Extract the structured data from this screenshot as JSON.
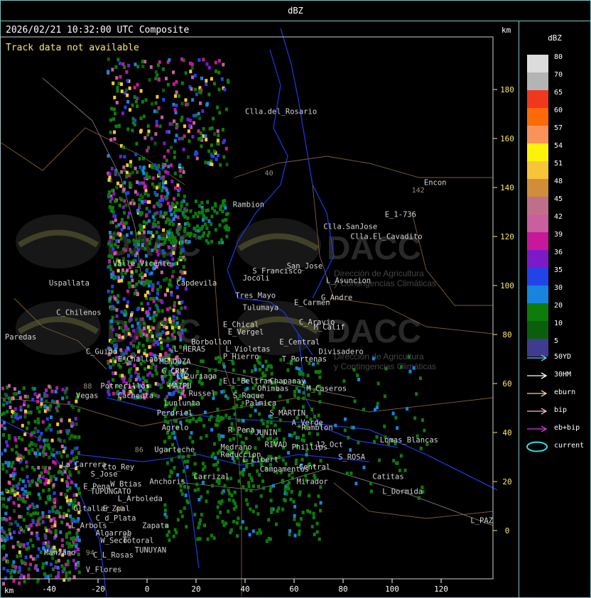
{
  "header": {
    "title": "dBZ"
  },
  "map": {
    "timestamp": "2026/02/21 10:32:00 UTC Composite",
    "notice": "Track data not available",
    "unit_top": "km",
    "unit_bottom": "km",
    "watermark_brand": "DACC",
    "watermark_line1": "Dirección de Agricultura",
    "watermark_line2": "y Contingencias Climáticas",
    "x_ticks": [
      "-40",
      "-20",
      "0",
      "20",
      "40",
      "60",
      "80",
      "100",
      "120"
    ],
    "y_ticks": [
      "180",
      "160",
      "140",
      "120",
      "100",
      "80",
      "60",
      "40",
      "20",
      "0"
    ],
    "places": [
      {
        "name": "Clla.del_Rosario",
        "x": 40,
        "y": 170
      },
      {
        "name": "Encon",
        "x": 113,
        "y": 141
      },
      {
        "name": "E_1-736",
        "x": 97,
        "y": 128
      },
      {
        "name": "Rambion",
        "x": 35,
        "y": 132
      },
      {
        "name": "Clla.SanJose",
        "x": 72,
        "y": 123
      },
      {
        "name": "Clla.El_Cavadito",
        "x": 83,
        "y": 119
      },
      {
        "name": "Uspallata",
        "x": -40,
        "y": 100
      },
      {
        "name": "C_Chilenos",
        "x": -37,
        "y": 88
      },
      {
        "name": "Valle_Vicente",
        "x": -14,
        "y": 108
      },
      {
        "name": "Capdevila",
        "x": 12,
        "y": 100
      },
      {
        "name": "S_Francisco",
        "x": 43,
        "y": 105
      },
      {
        "name": "San_Jose",
        "x": 57,
        "y": 107
      },
      {
        "name": "Jocoli",
        "x": 39,
        "y": 102
      },
      {
        "name": "L_Asuncion",
        "x": 73,
        "y": 101
      },
      {
        "name": "Tres_Mayo",
        "x": 36,
        "y": 95
      },
      {
        "name": "Tulumaya",
        "x": 39,
        "y": 90
      },
      {
        "name": "E_Carmen",
        "x": 60,
        "y": 92
      },
      {
        "name": "G_Andre",
        "x": 71,
        "y": 94
      },
      {
        "name": "C_Aravio",
        "x": 62,
        "y": 84
      },
      {
        "name": "M_Calif",
        "x": 68,
        "y": 82
      },
      {
        "name": "E_Chical",
        "x": 31,
        "y": 83
      },
      {
        "name": "E_Vergel",
        "x": 33,
        "y": 80
      },
      {
        "name": "Borbollon",
        "x": 18,
        "y": 76
      },
      {
        "name": "L_Violetas",
        "x": 32,
        "y": 73
      },
      {
        "name": "E_Central",
        "x": 54,
        "y": 76
      },
      {
        "name": "Divisadero",
        "x": 70,
        "y": 72
      },
      {
        "name": "L_HERAS",
        "x": 11,
        "y": 73
      },
      {
        "name": "P_Hierro",
        "x": 31,
        "y": 70
      },
      {
        "name": "C_Guido",
        "x": -25,
        "y": 72
      },
      {
        "name": "E_Challao",
        "x": -12,
        "y": 69
      },
      {
        "name": "MENDOZA",
        "x": 5,
        "y": 68
      },
      {
        "name": "T_Portenas",
        "x": 55,
        "y": 69
      },
      {
        "name": "G_CRUZ",
        "x": 6,
        "y": 64
      },
      {
        "name": "Luzuriaga",
        "x": 12,
        "y": 62
      },
      {
        "name": "Chapanay",
        "x": 50,
        "y": 60
      },
      {
        "name": "MAIPU",
        "x": 9,
        "y": 58
      },
      {
        "name": "E_L_Beltran",
        "x": 31,
        "y": 60
      },
      {
        "name": "Ohimbas",
        "x": 45,
        "y": 57
      },
      {
        "name": "M_Caseros",
        "x": 65,
        "y": 57
      },
      {
        "name": "Potrerillos",
        "x": -19,
        "y": 58
      },
      {
        "name": "Russel",
        "x": 17,
        "y": 55
      },
      {
        "name": "S_Roque",
        "x": 35,
        "y": 54
      },
      {
        "name": "Vegas",
        "x": -29,
        "y": 54
      },
      {
        "name": "Cacheuta",
        "x": -12,
        "y": 54
      },
      {
        "name": "Lunlunta",
        "x": 7,
        "y": 51
      },
      {
        "name": "Palmica",
        "x": 40,
        "y": 51
      },
      {
        "name": "S_MARTIN",
        "x": 50,
        "y": 47
      },
      {
        "name": "Perdriel",
        "x": 4,
        "y": 47
      },
      {
        "name": "A_Verde",
        "x": 59,
        "y": 43
      },
      {
        "name": "Ramblon",
        "x": 63,
        "y": 41
      },
      {
        "name": "Agrelo",
        "x": 6,
        "y": 41
      },
      {
        "name": "R_Pena",
        "x": 33,
        "y": 40
      },
      {
        "name": "JUNIN",
        "x": 44,
        "y": 39
      },
      {
        "name": "Lomas_Blancas",
        "x": 95,
        "y": 36
      },
      {
        "name": "Ugarteche",
        "x": 3,
        "y": 32
      },
      {
        "name": "Medrano",
        "x": 30,
        "y": 33
      },
      {
        "name": "RIVAD",
        "x": 48,
        "y": 34
      },
      {
        "name": "Phillips",
        "x": 59,
        "y": 33
      },
      {
        "name": "12_Oct",
        "x": 69,
        "y": 34
      },
      {
        "name": "Reduccion",
        "x": 30,
        "y": 30
      },
      {
        "name": "L_Libert",
        "x": 39,
        "y": 28
      },
      {
        "name": "S_ROSA",
        "x": 78,
        "y": 29
      },
      {
        "name": "La_Carrera",
        "x": -35,
        "y": 26
      },
      {
        "name": "Cto_Rey",
        "x": -18,
        "y": 25
      },
      {
        "name": "Campamentos",
        "x": 46,
        "y": 24
      },
      {
        "name": "Central",
        "x": 62,
        "y": 25
      },
      {
        "name": "S_Jose",
        "x": -23,
        "y": 22
      },
      {
        "name": "Carrizal",
        "x": 19,
        "y": 21
      },
      {
        "name": "Catitas",
        "x": 92,
        "y": 21
      },
      {
        "name": "W_Btias",
        "x": -15,
        "y": 18
      },
      {
        "name": "Anchoris",
        "x": 1,
        "y": 19
      },
      {
        "name": "Mirador",
        "x": 61,
        "y": 19
      },
      {
        "name": "E_Pena",
        "x": -26,
        "y": 17
      },
      {
        "name": "TUPUNGATO",
        "x": -23,
        "y": 15
      },
      {
        "name": "L_Dormida",
        "x": 96,
        "y": 15
      },
      {
        "name": "L_Arboleda",
        "x": -12,
        "y": 12
      },
      {
        "name": "Gltallar",
        "x": -30,
        "y": 8
      },
      {
        "name": "E_Zpal",
        "x": -18,
        "y": 8
      },
      {
        "name": "C_d_Plata",
        "x": -21,
        "y": 4
      },
      {
        "name": "L_Arbols",
        "x": -31,
        "y": 1
      },
      {
        "name": "Zapata",
        "x": -2,
        "y": 1
      },
      {
        "name": "L_PAZ",
        "x": 132,
        "y": 3
      },
      {
        "name": "Algarrob",
        "x": -21,
        "y": -2
      },
      {
        "name": "W_Seco",
        "x": -19,
        "y": -5
      },
      {
        "name": "Totoral",
        "x": -10,
        "y": -5
      },
      {
        "name": "TUNUYAN",
        "x": -5,
        "y": -9
      },
      {
        "name": "Manzano",
        "x": -42,
        "y": -10
      },
      {
        "name": "C_L_Rosas",
        "x": -22,
        "y": -11
      },
      {
        "name": "V_Flores",
        "x": -25,
        "y": -17
      },
      {
        "name": "Paredas",
        "x": -58,
        "y": 78
      }
    ],
    "road_numbers": [
      {
        "label": "40",
        "x": 48,
        "y": 145
      },
      {
        "label": "142",
        "x": 108,
        "y": 138
      },
      {
        "label": "88",
        "x": -26,
        "y": 58
      },
      {
        "label": "86",
        "x": -5,
        "y": 32
      },
      {
        "label": "40",
        "x": -13,
        "y": 8
      },
      {
        "label": "94",
        "x": -25,
        "y": -10
      },
      {
        "label": "40",
        "x": -10,
        "y": -3
      }
    ]
  },
  "legend": {
    "title": "dBZ",
    "bins": [
      {
        "label": "80",
        "color": "#dcdcdc"
      },
      {
        "label": "70",
        "color": "#b4b4b4"
      },
      {
        "label": "65",
        "color": "#f0381e"
      },
      {
        "label": "60",
        "color": "#fc6a08"
      },
      {
        "label": "57",
        "color": "#f9935a"
      },
      {
        "label": "54",
        "color": "#fcf20c"
      },
      {
        "label": "51",
        "color": "#f7c539"
      },
      {
        "label": "48",
        "color": "#d28d3a"
      },
      {
        "label": "45",
        "color": "#c06f8a"
      },
      {
        "label": "42",
        "color": "#c95f9d"
      },
      {
        "label": "39",
        "color": "#c7179b"
      },
      {
        "label": "36",
        "color": "#7c1ac9"
      },
      {
        "label": "35",
        "color": "#2243e8"
      },
      {
        "label": "30",
        "color": "#1784de"
      },
      {
        "label": "20",
        "color": "#0d7c0c"
      },
      {
        "label": "10",
        "color": "#0b5e0c"
      },
      {
        "label": "5",
        "color": "#3f3b8e"
      }
    ],
    "tracks": [
      {
        "label": "50YD",
        "color": "#5fd3e0"
      },
      {
        "label": "30HM",
        "color": "#ffffff"
      },
      {
        "label": "eburn",
        "color": "#f2cf98"
      },
      {
        "label": "bip",
        "color": "#f4b9c8"
      },
      {
        "label": "eb+bip",
        "color": "#d33ce0"
      },
      {
        "label": "current",
        "color": "#2ee0e8"
      }
    ]
  }
}
